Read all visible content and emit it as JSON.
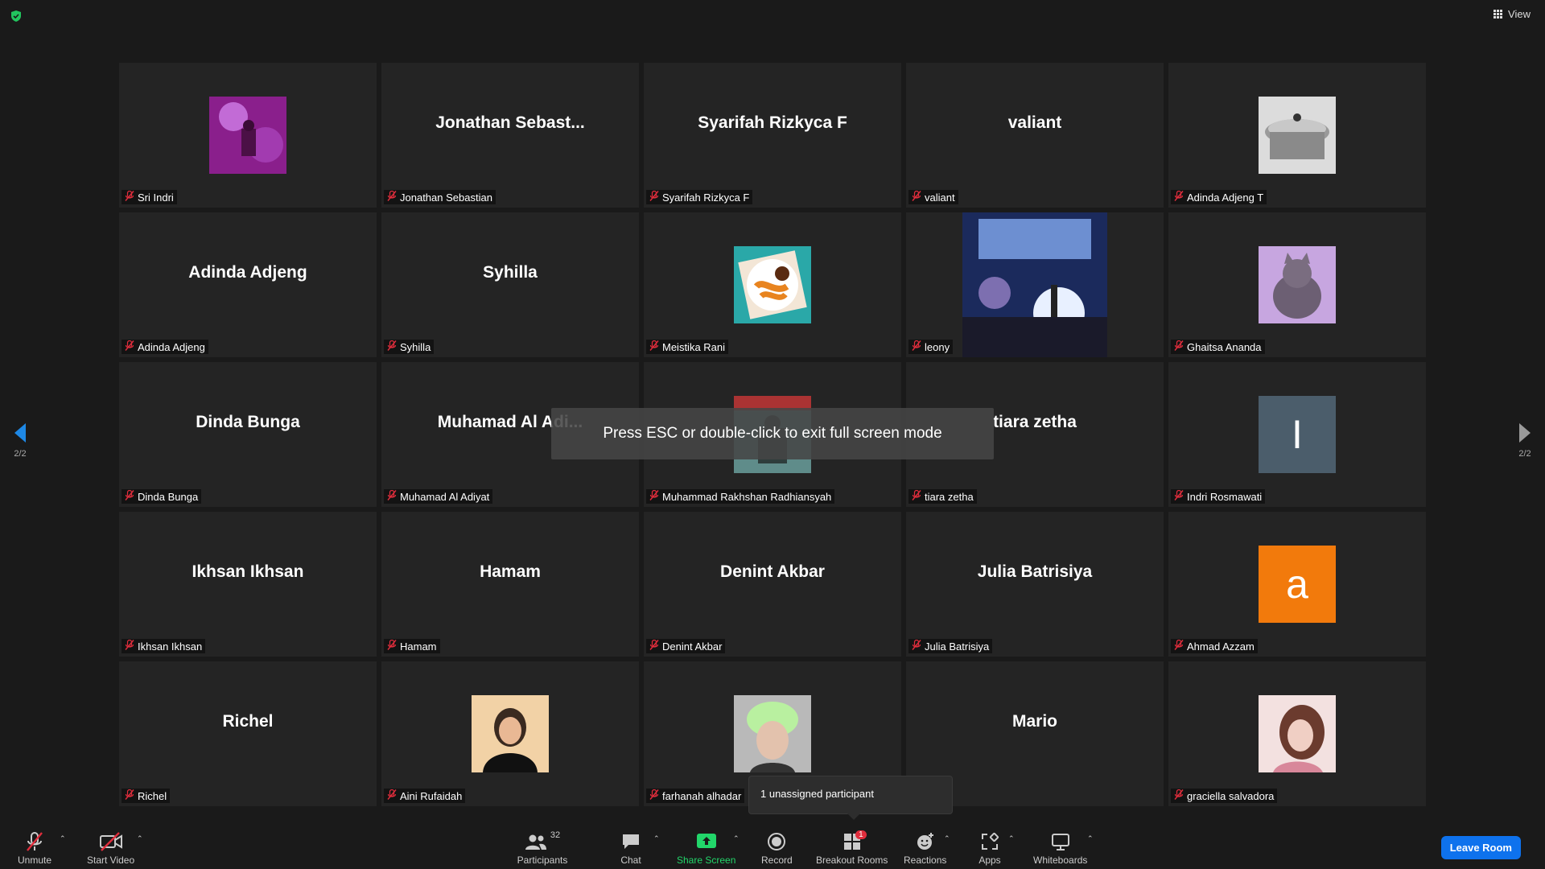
{
  "top": {
    "view_label": "View"
  },
  "toast": {
    "text": "Press ESC or double-click to exit full screen mode"
  },
  "page_nav": {
    "left": "2/2",
    "right": "2/2"
  },
  "tiles": [
    {
      "big": "",
      "pic": "photo-purple",
      "label": "Sri Indri"
    },
    {
      "big": "Jonathan  Sebast...",
      "label": "Jonathan Sebastian"
    },
    {
      "big": "Syarifah Rizkyca F",
      "label": "Syarifah Rizkyca F"
    },
    {
      "big": "valiant",
      "label": "valiant"
    },
    {
      "big": "",
      "pic": "photo-pot",
      "label": "Adinda Adjeng T"
    },
    {
      "big": "Adinda Adjeng",
      "label": "Adinda Adjeng"
    },
    {
      "big": "Syhilla",
      "label": "Syhilla"
    },
    {
      "big": "",
      "pic": "photo-food",
      "label": "Meistika Rani"
    },
    {
      "big": "",
      "pic": "photo-stage",
      "label": "leony"
    },
    {
      "big": "",
      "pic": "photo-cat",
      "label": "Ghaitsa Ananda"
    },
    {
      "big": "Dinda Bunga",
      "label": "Dinda Bunga"
    },
    {
      "big": "Muhamad  Al  Adi...",
      "label": "Muhamad Al Adiyat"
    },
    {
      "big": "",
      "pic": "photo-street",
      "label": "Muhammad Rakhshan Radhiansyah"
    },
    {
      "big": "tiara zetha",
      "label": "tiara zetha"
    },
    {
      "big": "",
      "pic": "avatar-I",
      "avatar_letter": "I",
      "label": "Indri Rosmawati"
    },
    {
      "big": "Ikhsan Ikhsan",
      "label": "Ikhsan Ikhsan"
    },
    {
      "big": "Hamam",
      "label": "Hamam"
    },
    {
      "big": "Denint Akbar",
      "label": "Denint Akbar"
    },
    {
      "big": "Julia Batrisiya",
      "label": "Julia Batrisiya"
    },
    {
      "big": "",
      "pic": "avatar-a",
      "avatar_letter": "a",
      "label": "Ahmad Azzam"
    },
    {
      "big": "Richel",
      "label": "Richel"
    },
    {
      "big": "",
      "pic": "photo-girl",
      "label": "Aini Rufaidah"
    },
    {
      "big": "",
      "pic": "photo-boy",
      "label": "farhanah alhadar"
    },
    {
      "big": "Mario",
      "label": ""
    },
    {
      "big": "",
      "pic": "photo-girl2",
      "label": "graciella salvadora"
    }
  ],
  "tooltip": {
    "text": "1 unassigned participant"
  },
  "toolbar": {
    "unmute": "Unmute",
    "start_video": "Start Video",
    "participants": "Participants",
    "participants_count": "32",
    "chat": "Chat",
    "share_screen": "Share Screen",
    "record": "Record",
    "breakout_rooms": "Breakout Rooms",
    "breakout_badge": "1",
    "reactions": "Reactions",
    "apps": "Apps",
    "whiteboards": "Whiteboards",
    "leave": "Leave Room"
  },
  "colors": {
    "share_green": "#22d66a",
    "leave_blue": "#0e72ed",
    "mute_red": "#e02d3c",
    "avatar_orange": "#f27a0c",
    "avatar_slate": "#4b5d6b"
  }
}
